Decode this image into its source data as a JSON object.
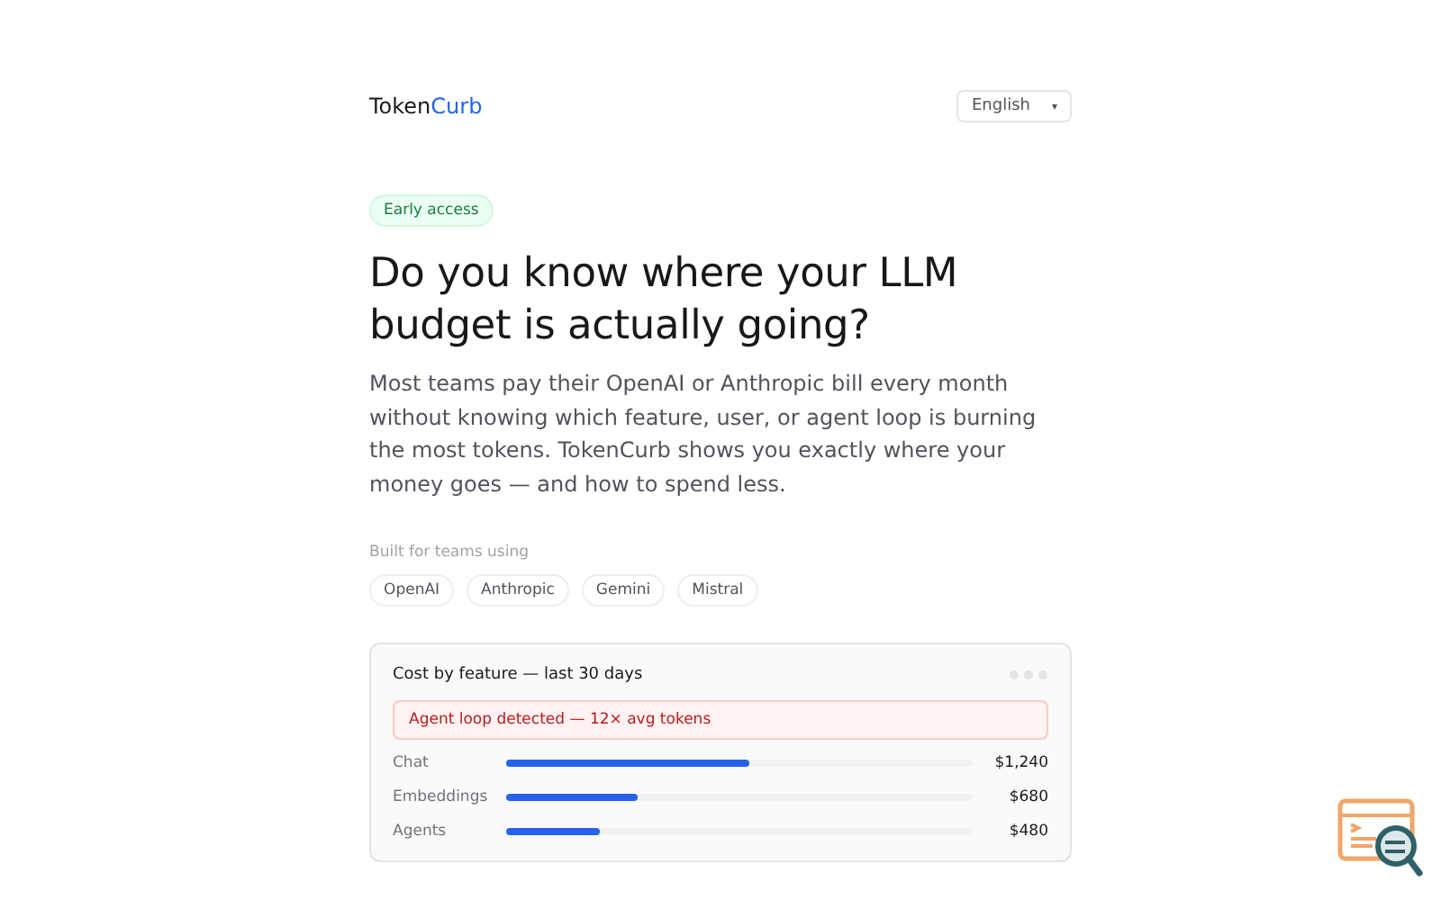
{
  "brand": {
    "name": "Token",
    "accent": "Curb"
  },
  "language": {
    "value": "English",
    "caret": "▾"
  },
  "badge": "Early access",
  "headline": "Do you know where your LLM budget is actually going?",
  "intro": "Most teams pay their OpenAI or Anthropic bill every month without knowing which feature, user, or agent loop is burning the most tokens. TokenCurb shows you exactly where your money goes — and how to spend less.",
  "providers": {
    "label": "Built for teams using",
    "items": [
      "OpenAI",
      "Anthropic",
      "Gemini",
      "Mistral"
    ]
  },
  "card": {
    "title": "Cost by feature — last 30 days",
    "alert": "Agent loop detected — 12× avg tokens",
    "rows": [
      {
        "name": "Chat",
        "level": 0.52,
        "amount": "$1,240"
      },
      {
        "name": "Embeddings",
        "level": 0.28,
        "amount": "$680"
      },
      {
        "name": "Agents",
        "level": 0.2,
        "amount": "$480"
      }
    ]
  }
}
